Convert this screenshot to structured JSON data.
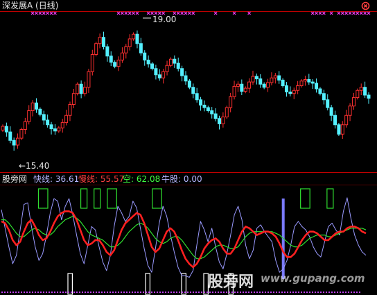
{
  "window": {
    "title": "深发展A (日线)"
  },
  "chart_data": [
    {
      "type": "candlestick",
      "title": "深发展A (日线)",
      "annotations": {
        "high": "19.00",
        "low": "←15.40"
      },
      "high_value": 19.0,
      "low_value": 15.4,
      "ylim": [
        14.6,
        19.6
      ],
      "colors": {
        "up": "#ff3030",
        "down": "#54f0ff",
        "markers": "#ff40ff"
      },
      "closes": [
        16.0,
        15.82,
        15.55,
        15.4,
        15.62,
        15.9,
        16.15,
        16.5,
        16.75,
        16.55,
        16.38,
        16.2,
        16.05,
        15.92,
        15.85,
        15.95,
        16.12,
        16.35,
        16.7,
        17.05,
        17.35,
        17.05,
        17.25,
        17.75,
        18.3,
        18.65,
        18.85,
        18.55,
        18.25,
        18.05,
        17.92,
        18.12,
        18.35,
        18.55,
        18.8,
        18.95,
        18.65,
        18.35,
        18.12,
        18.0,
        17.85,
        17.65,
        17.55,
        17.75,
        17.95,
        18.15,
        18.02,
        17.85,
        17.62,
        17.45,
        17.25,
        17.05,
        16.85,
        16.68,
        16.6,
        16.5,
        16.4,
        16.25,
        16.08,
        16.3,
        16.6,
        16.95,
        17.28,
        17.35,
        17.12,
        17.22,
        17.42,
        17.6,
        17.52,
        17.35,
        17.25,
        17.4,
        17.55,
        17.62,
        17.48,
        17.3,
        17.1,
        17.05,
        17.15,
        17.3,
        17.45,
        17.5,
        17.42,
        17.38,
        17.2,
        17.05,
        16.85,
        16.6,
        16.35,
        16.05,
        15.75,
        16.05,
        16.35,
        16.65,
        16.92,
        17.15,
        17.25,
        17.0,
        16.9
      ],
      "marker_positions": [
        8,
        9,
        10,
        11,
        12,
        13,
        14,
        31,
        32,
        33,
        34,
        35,
        36,
        39,
        40,
        41,
        42,
        43,
        46,
        47,
        48,
        49,
        50,
        51,
        57,
        62,
        66,
        83,
        84,
        85,
        86,
        88,
        90,
        91,
        92,
        93,
        94,
        95,
        96,
        97,
        98
      ]
    },
    {
      "type": "line",
      "indicator_name": "股旁网",
      "series": [
        {
          "name": "快线",
          "current": "36.61",
          "color": "#9a9aff",
          "values": [
            82,
            60,
            38,
            18,
            28,
            58,
            88,
            90,
            62,
            38,
            22,
            30,
            52,
            78,
            95,
            92,
            70,
            86,
            95,
            76,
            52,
            30,
            18,
            40,
            62,
            58,
            38,
            20,
            10,
            28,
            62,
            86,
            78,
            68,
            74,
            92,
            84,
            60,
            36,
            16,
            8,
            36,
            66,
            86,
            74,
            52,
            32,
            14,
            4,
            4,
            2,
            10,
            40,
            68,
            58,
            44,
            60,
            38,
            20,
            12,
            30,
            52,
            76,
            86,
            70,
            40,
            24,
            34,
            60,
            64,
            56,
            50,
            44,
            22,
            8,
            12,
            22,
            40,
            62,
            68,
            62,
            58,
            50,
            38,
            30,
            26,
            44,
            62,
            66,
            58,
            52,
            80,
            96,
            72,
            52,
            40,
            32,
            28
          ]
        },
        {
          "name": "慢线",
          "current": "55.57",
          "color": "#ff2020",
          "values": [
            68,
            66,
            58,
            46,
            40,
            44,
            56,
            66,
            70,
            62,
            52,
            46,
            48,
            56,
            66,
            74,
            78,
            80,
            80,
            78,
            70,
            58,
            46,
            40,
            42,
            46,
            46,
            40,
            32,
            28,
            34,
            46,
            58,
            66,
            70,
            74,
            78,
            76,
            66,
            52,
            38,
            32,
            36,
            46,
            56,
            60,
            56,
            46,
            34,
            24,
            18,
            14,
            18,
            26,
            36,
            42,
            46,
            48,
            44,
            36,
            30,
            30,
            36,
            46,
            56,
            62,
            60,
            56,
            52,
            54,
            56,
            56,
            54,
            50,
            42,
            32,
            26,
            26,
            30,
            38,
            46,
            52,
            56,
            56,
            54,
            50,
            46,
            46,
            50,
            54,
            56,
            56,
            60,
            62,
            62,
            60,
            56,
            54
          ]
        },
        {
          "name": "空",
          "current": "62.08",
          "color": "#30e030",
          "values": [
            70,
            70,
            66,
            60,
            54,
            50,
            50,
            54,
            58,
            60,
            58,
            54,
            52,
            52,
            56,
            62,
            66,
            70,
            72,
            74,
            72,
            68,
            62,
            56,
            52,
            50,
            48,
            46,
            42,
            38,
            38,
            40,
            44,
            50,
            56,
            60,
            64,
            66,
            64,
            60,
            54,
            48,
            44,
            42,
            44,
            48,
            50,
            50,
            46,
            40,
            34,
            28,
            24,
            24,
            26,
            30,
            34,
            38,
            40,
            40,
            38,
            36,
            36,
            38,
            44,
            50,
            54,
            56,
            56,
            56,
            56,
            56,
            56,
            54,
            52,
            48,
            44,
            40,
            38,
            38,
            40,
            44,
            48,
            50,
            52,
            52,
            52,
            50,
            50,
            52,
            54,
            56,
            58,
            60,
            60,
            60,
            60,
            58
          ]
        },
        {
          "name": "牛股",
          "current": "0.00",
          "color": "#9a9aff"
        }
      ],
      "ylim": [
        0,
        100
      ],
      "green_boxes": [
        [
          14,
          3
        ],
        [
          30,
          2
        ],
        [
          35,
          2
        ],
        [
          40,
          3
        ],
        [
          57,
          3
        ],
        [
          113,
          3
        ],
        [
          123,
          2
        ]
      ],
      "white_boxes": [
        [
          24,
          2
        ],
        [
          52,
          2
        ],
        [
          65,
          2
        ],
        [
          73,
          2
        ],
        [
          82,
          2
        ]
      ],
      "spike_position": 75
    }
  ],
  "watermark": {
    "text": "股旁网",
    "url": "www.gupang.com"
  }
}
